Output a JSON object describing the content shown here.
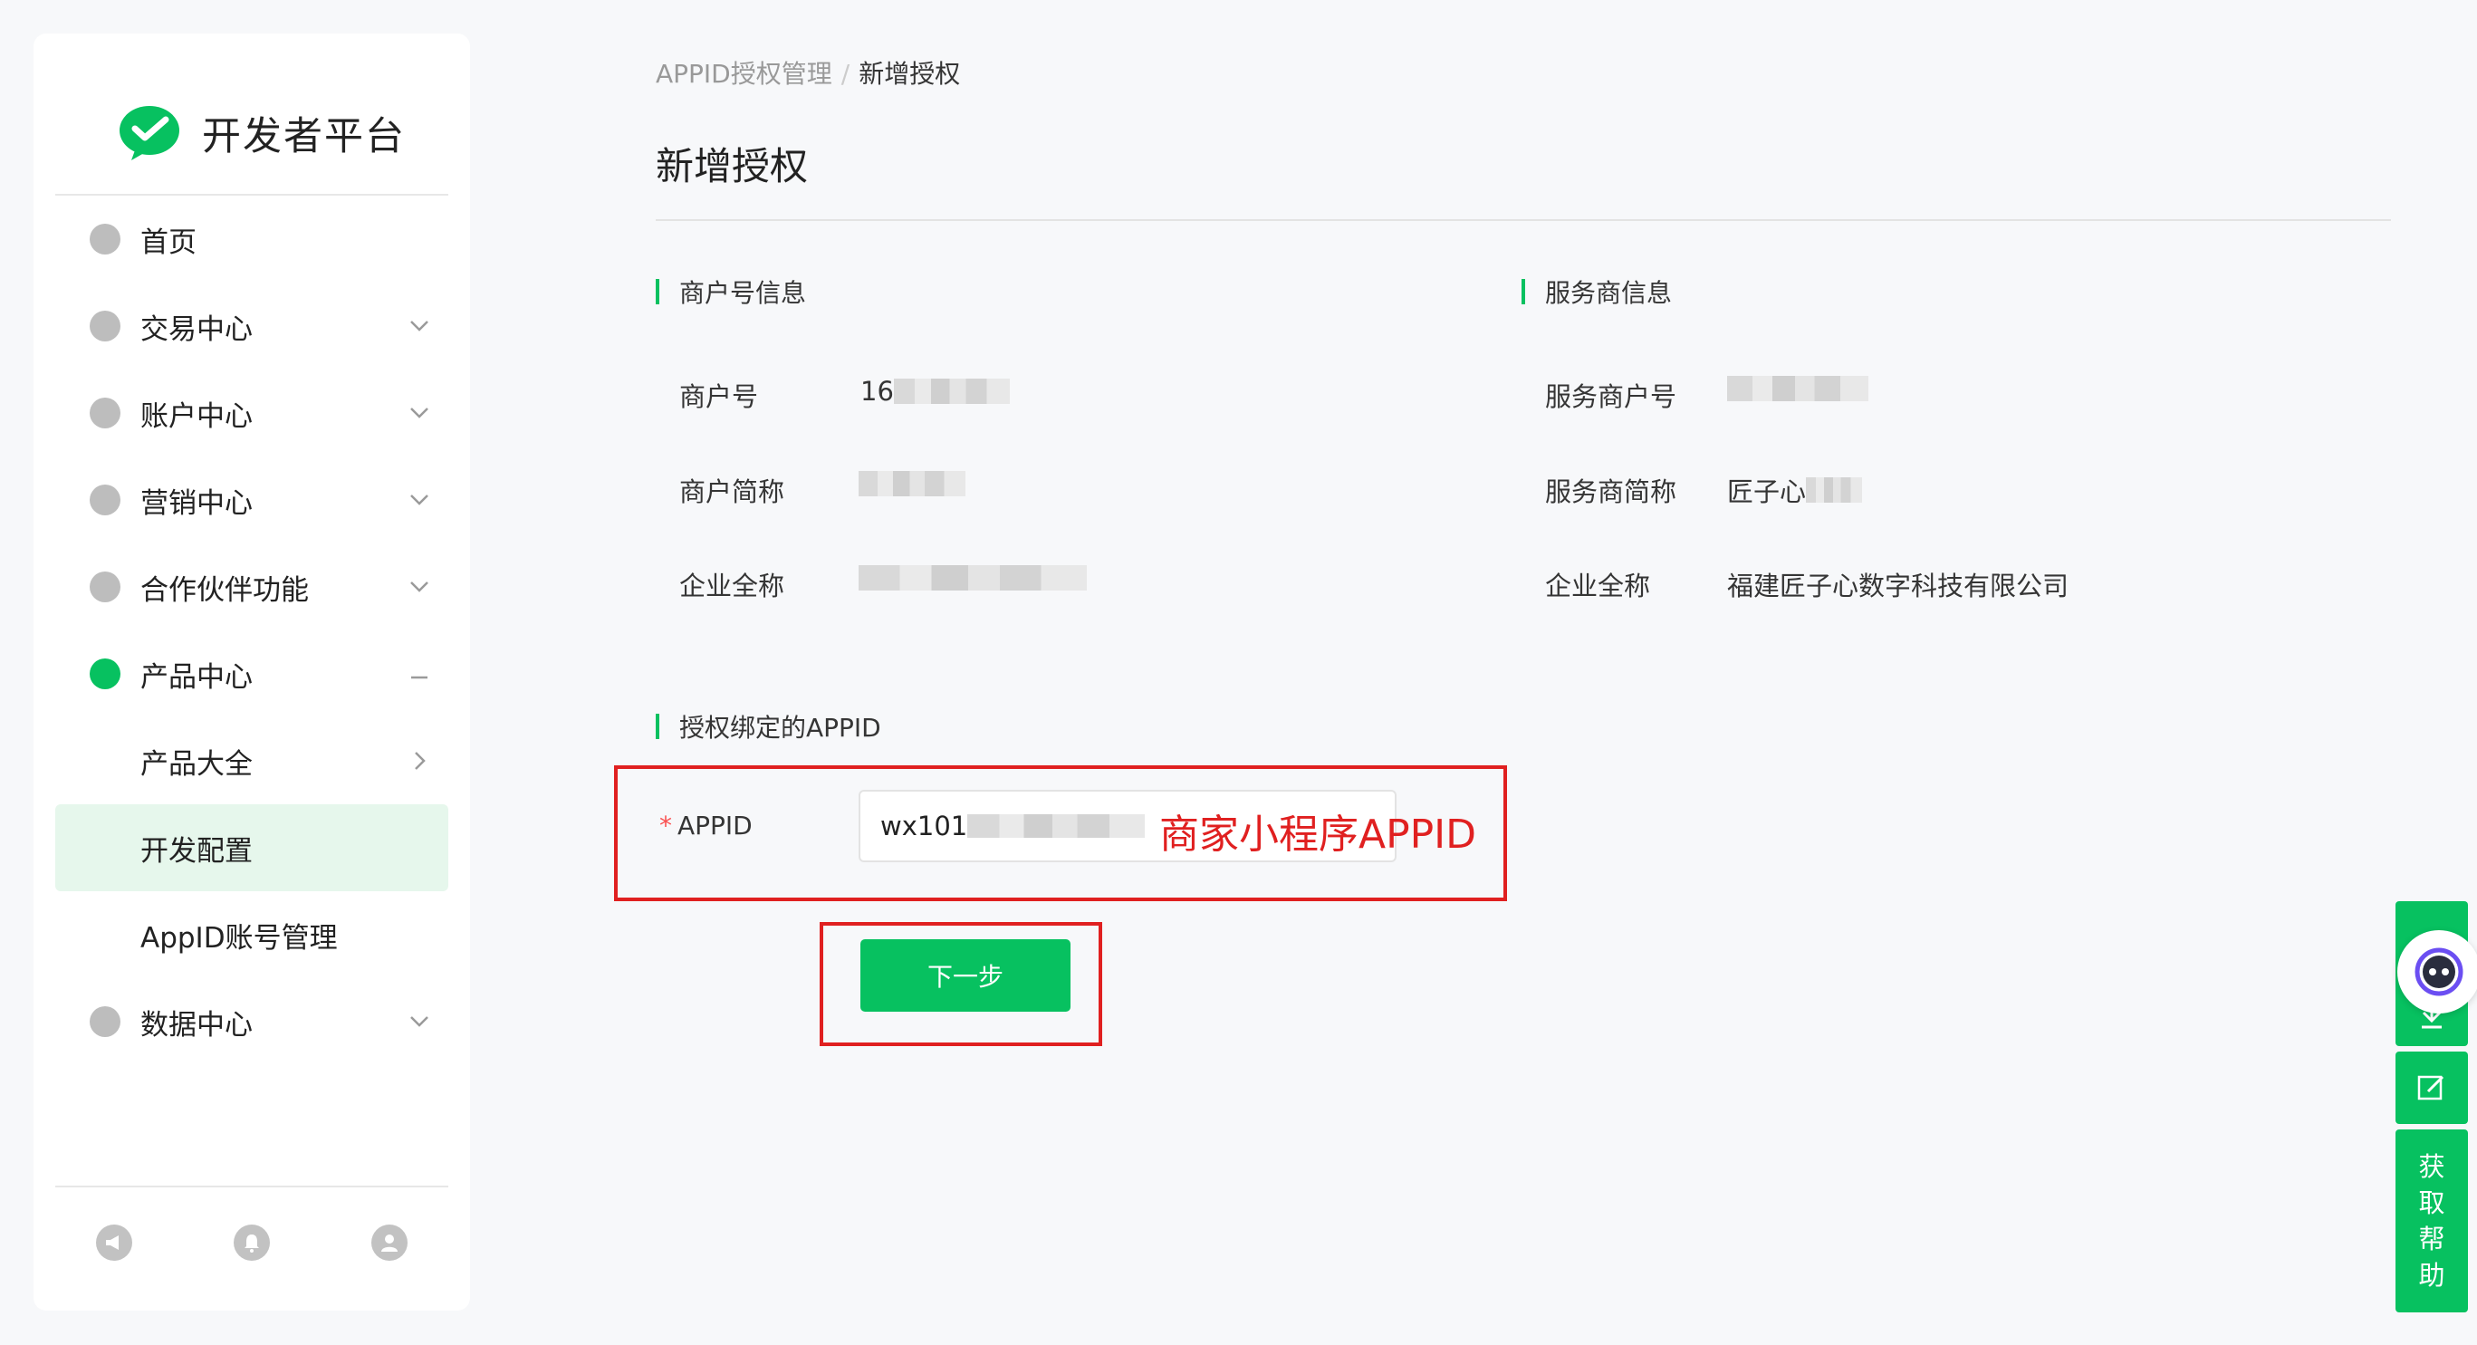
{
  "sidebar": {
    "logo_text": "开发者平台",
    "items": [
      {
        "label": "首页"
      },
      {
        "label": "交易中心"
      },
      {
        "label": "账户中心"
      },
      {
        "label": "营销中心"
      },
      {
        "label": "合作伙伴功能"
      },
      {
        "label": "产品中心"
      },
      {
        "label": "产品大全"
      },
      {
        "label": "开发配置"
      },
      {
        "label": "AppID账号管理"
      },
      {
        "label": "数据中心"
      }
    ],
    "footer_icons": [
      "megaphone-icon",
      "bell-icon",
      "user-icon"
    ]
  },
  "breadcrumb": {
    "parent": "APPID授权管理",
    "separator": "/",
    "current": "新增授权"
  },
  "page": {
    "title": "新增授权"
  },
  "merchant_info": {
    "section_title": "商户号信息",
    "fields": [
      {
        "label": "商户号",
        "value": "16"
      },
      {
        "label": "商户简称",
        "value": ""
      },
      {
        "label": "企业全称",
        "value": ""
      }
    ]
  },
  "provider_info": {
    "section_title": "服务商信息",
    "fields": [
      {
        "label": "服务商户号",
        "value": ""
      },
      {
        "label": "服务商简称",
        "value": "匠子心"
      },
      {
        "label": "企业全称",
        "value": "福建匠子心数字科技有限公司"
      }
    ]
  },
  "appid_section": {
    "section_title": "授权绑定的APPID",
    "required_mark": "*",
    "label": "APPID",
    "input_value": "wx101"
  },
  "annotation": {
    "text": "商家小程序APPID",
    "color": "#e02020"
  },
  "next_button": {
    "label": "下一步"
  },
  "help_bar": {
    "help_text": "获取帮助"
  },
  "colors": {
    "accent": "#07c160",
    "annotation": "#e02020"
  }
}
